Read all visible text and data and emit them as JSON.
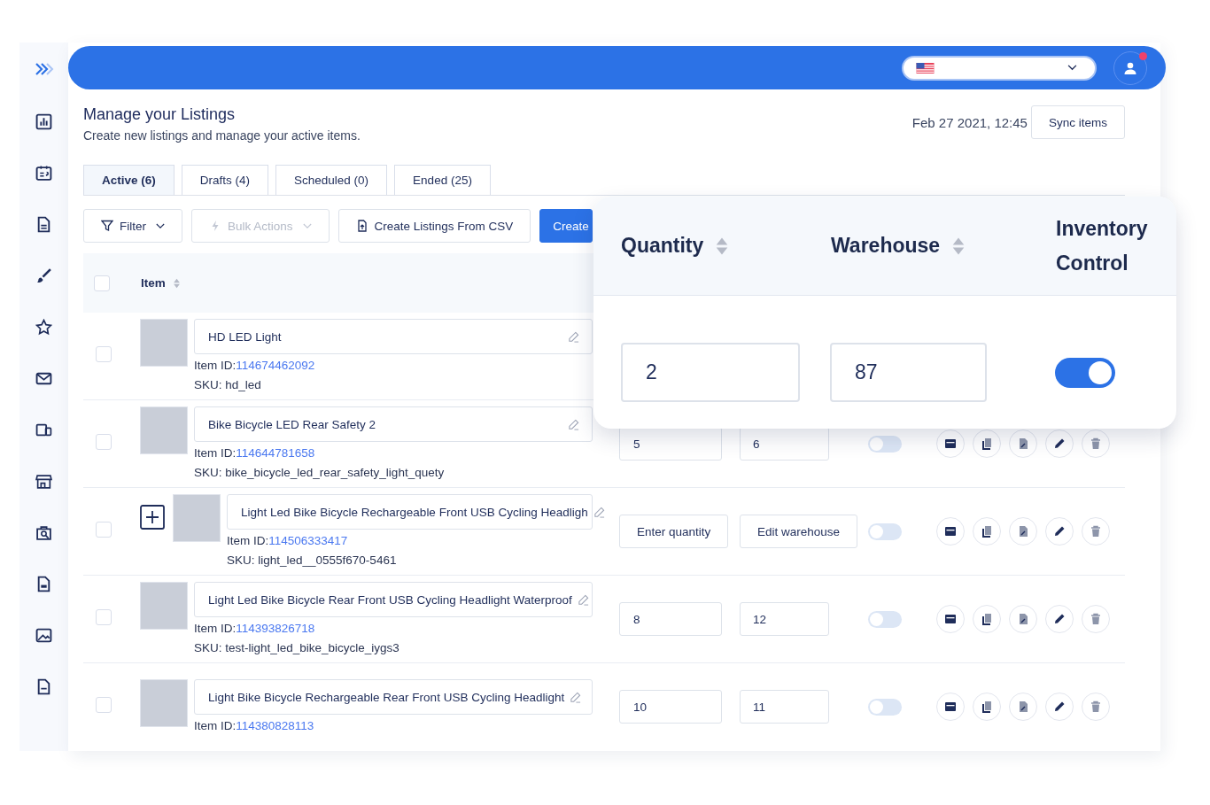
{
  "header": {
    "language_dropdown": {
      "open": false
    }
  },
  "page": {
    "title": "Manage your Listings",
    "subtitle": "Create new listings and manage your active items.",
    "last_sync": "Feb 27 2021, 12:45",
    "sync_button": "Sync items"
  },
  "tabs": [
    {
      "label": "Active (6)",
      "selected": true
    },
    {
      "label": "Drafts (4)",
      "selected": false
    },
    {
      "label": "Scheduled (0)",
      "selected": false
    },
    {
      "label": "Ended (25)",
      "selected": false
    }
  ],
  "toolbar": {
    "filter": "Filter",
    "bulk_actions": {
      "label": "Bulk Actions",
      "disabled": true
    },
    "csv_button": "Create Listings From CSV",
    "create_button": "Create"
  },
  "table": {
    "select_all_checked": false,
    "columns": [
      {
        "label": "Item"
      }
    ],
    "rows": [
      {
        "checked": false,
        "expandable": false,
        "title": "HD LED Light",
        "item_id_label": "Item ID:",
        "item_id": "114674462092",
        "sku": "SKU: hd_led"
      },
      {
        "checked": false,
        "expandable": false,
        "title": "Bike Bicycle LED Rear Safety 2",
        "item_id_label": "Item ID:",
        "item_id": "114644781658",
        "sku": "SKU: bike_bicycle_led_rear_safety_light_quety",
        "quantity": {
          "kind": "field",
          "value": "5"
        },
        "warehouse": {
          "kind": "field",
          "value": "6"
        },
        "inventory_control": {
          "on": false
        }
      },
      {
        "checked": false,
        "expandable": true,
        "title": "Light Led Bike Bicycle Rechargeable Front USB Cycling Headligh",
        "item_id_label": "Item ID:",
        "item_id": "114506333417",
        "sku": "SKU: light_led__0555f670-5461",
        "quantity": {
          "kind": "button",
          "value": "Enter quantity"
        },
        "warehouse": {
          "kind": "button",
          "value": "Edit warehouse"
        },
        "inventory_control": {
          "on": false
        }
      },
      {
        "checked": false,
        "expandable": false,
        "title": "Light Led Bike Bicycle Rear Front  USB Cycling Headlight Waterproof",
        "item_id_label": "Item ID:",
        "item_id": "114393826718",
        "sku": "SKU: test-light_led_bike_bicycle_iygs3",
        "quantity": {
          "kind": "field",
          "value": "8"
        },
        "warehouse": {
          "kind": "field",
          "value": "12"
        },
        "inventory_control": {
          "on": false
        }
      },
      {
        "checked": false,
        "expandable": false,
        "title": "Light Bike Bicycle Rechargeable Rear Front USB Cycling Headlight",
        "item_id_label": "Item ID:",
        "item_id": "114380828113",
        "quantity": {
          "kind": "field",
          "value": "10"
        },
        "warehouse": {
          "kind": "field",
          "value": "11"
        },
        "inventory_control": {
          "on": false
        }
      }
    ]
  },
  "zoom_card": {
    "columns": [
      {
        "label": "Quantity",
        "sortable": true
      },
      {
        "label": "Warehouse",
        "sortable": true
      },
      {
        "label": "Inventory Control",
        "sortable": false
      }
    ],
    "row": {
      "quantity": "2",
      "warehouse": "87",
      "inventory_control": {
        "on": true
      }
    }
  }
}
